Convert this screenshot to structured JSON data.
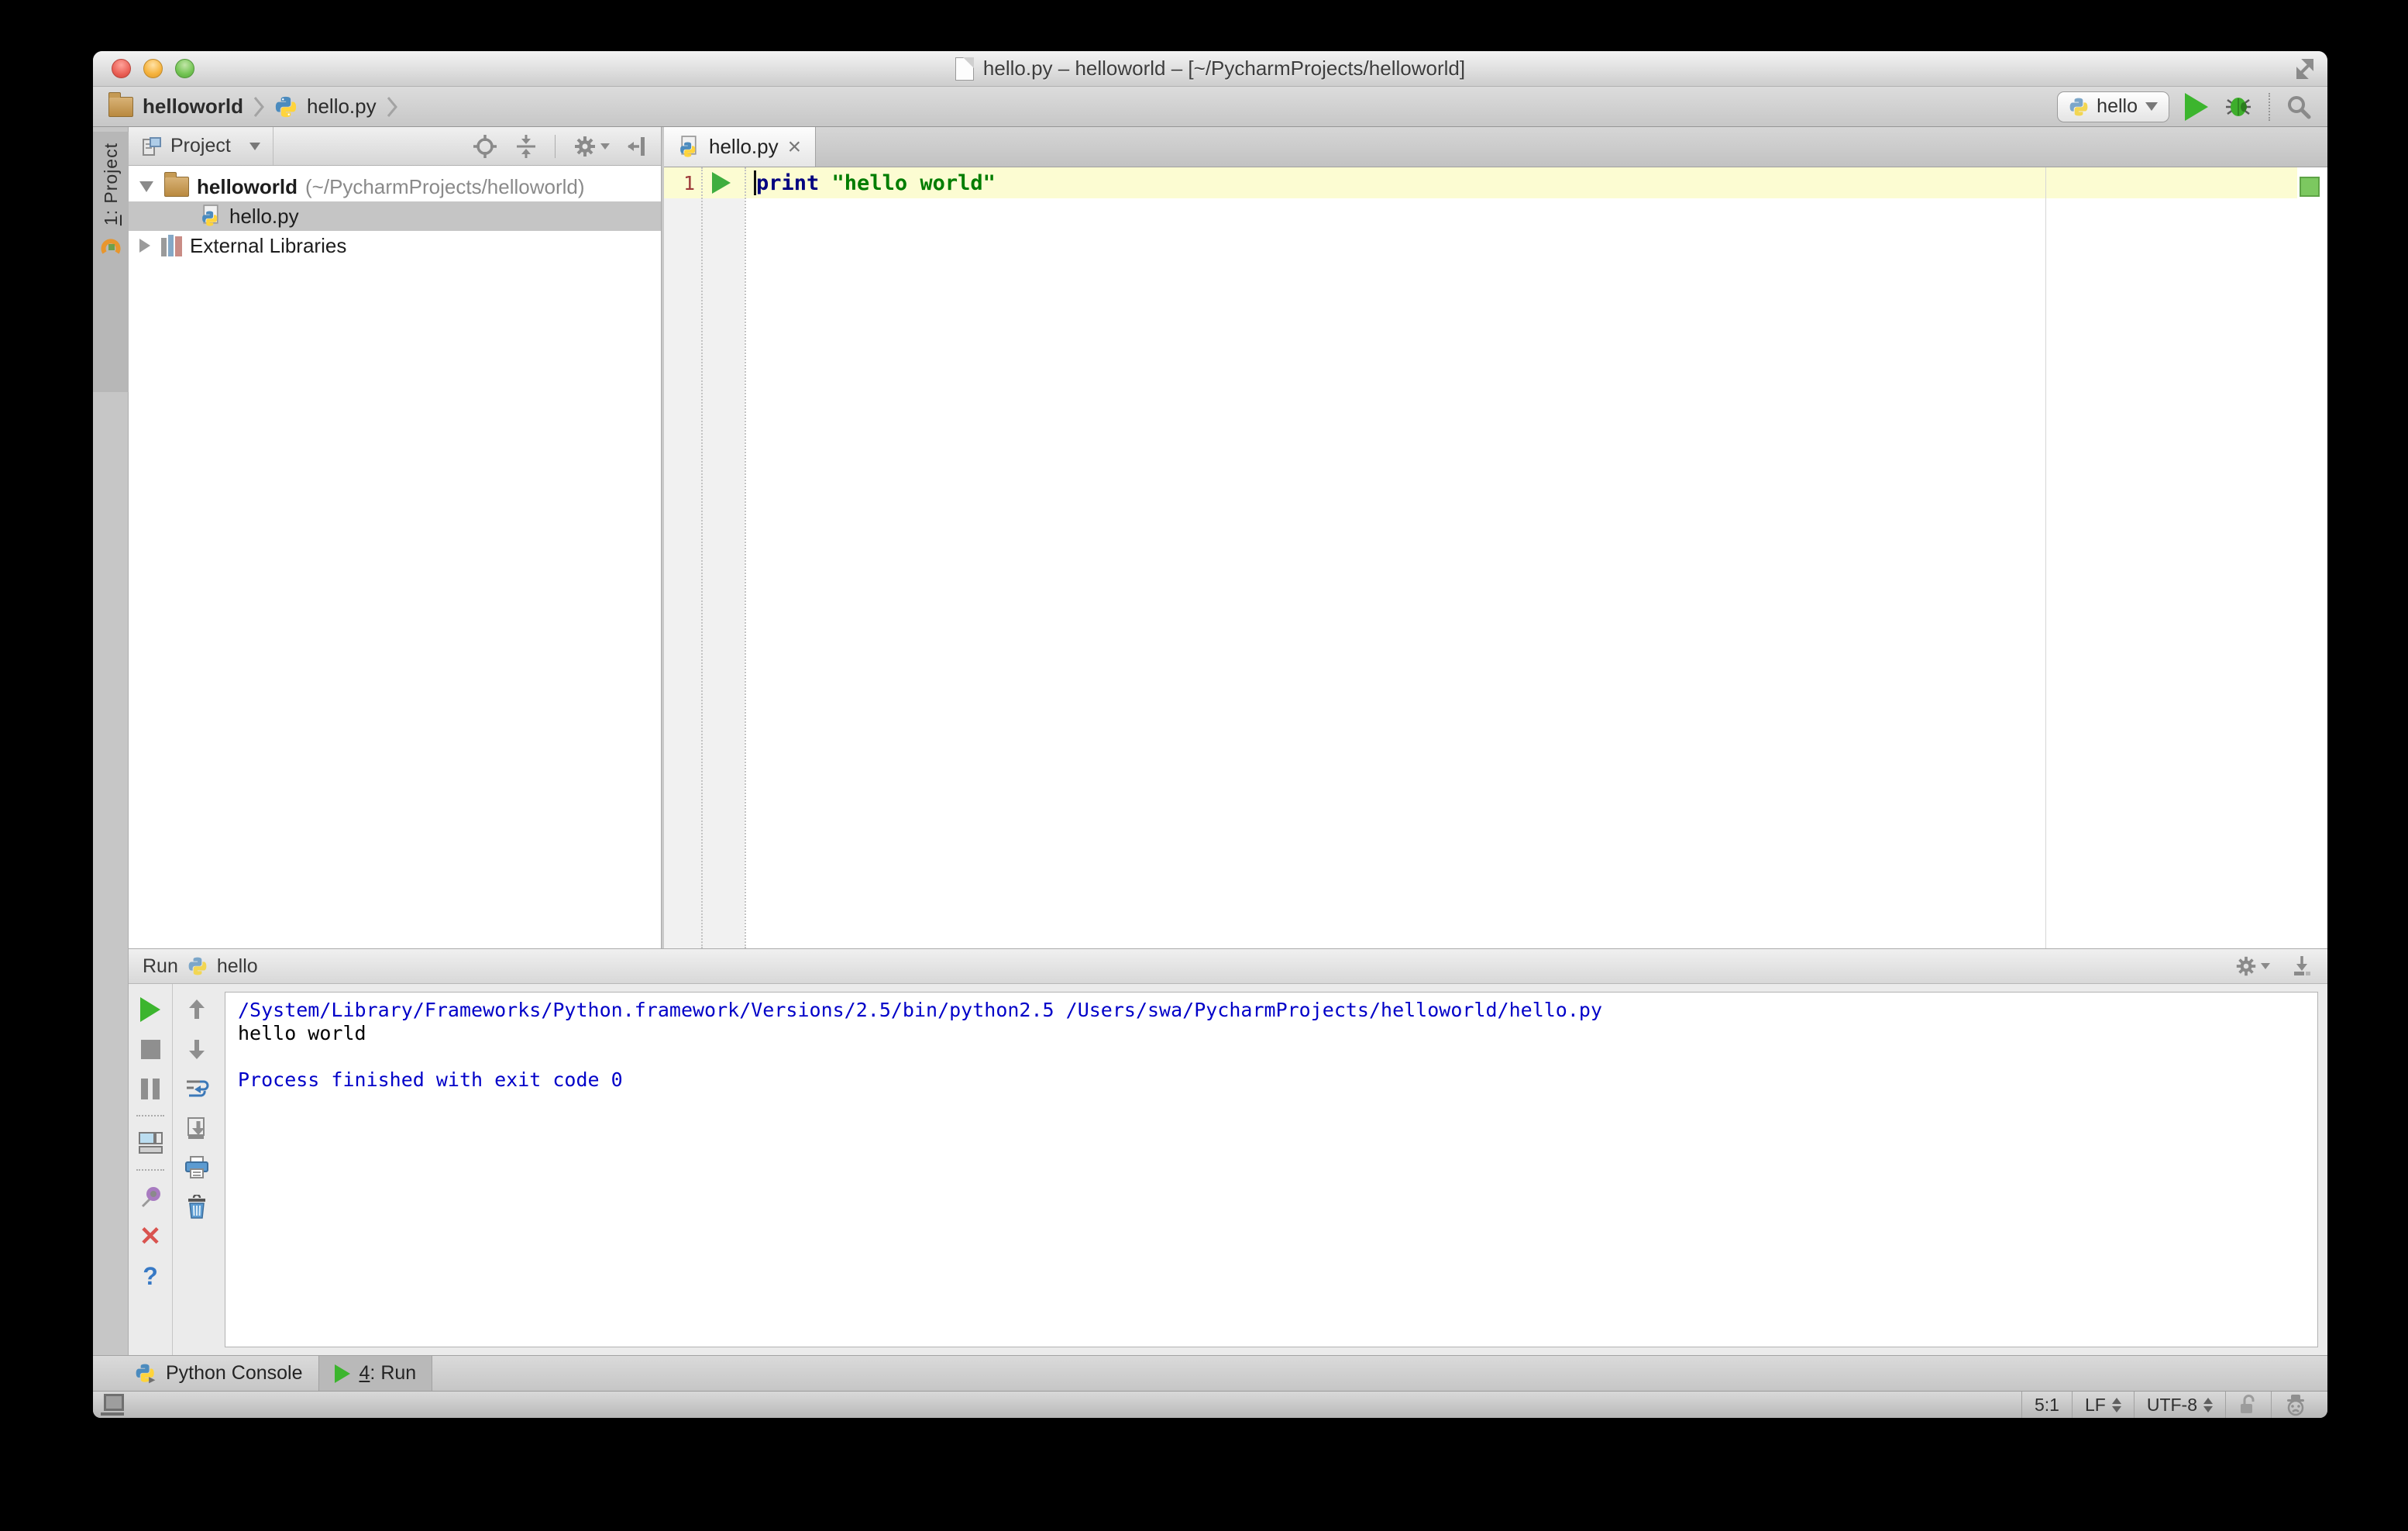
{
  "titlebar": {
    "title": "hello.py – helloworld – [~/PycharmProjects/helloworld]"
  },
  "navbar": {
    "breadcrumb_project": "helloworld",
    "breadcrumb_file": "hello.py",
    "run_config_label": "hello"
  },
  "tool_stripe": {
    "project_number": "1",
    "project_label": ": Project"
  },
  "project_panel": {
    "view_selector": "Project",
    "tree": {
      "root_name": "helloworld",
      "root_path": "(~/PycharmProjects/helloworld)",
      "file_name": "hello.py",
      "libraries_label": "External Libraries"
    }
  },
  "editor": {
    "tab_label": "hello.py",
    "line_number": "1",
    "code_keyword": "print",
    "code_string": "\"hello world\""
  },
  "run_panel": {
    "title": "Run",
    "config_name": "hello",
    "console_lines": [
      {
        "text": "/System/Library/Frameworks/Python.framework/Versions/2.5/bin/python2.5 /Users/swa/PycharmProjects/helloworld/hello.py",
        "type": "system"
      },
      {
        "text": "hello world",
        "type": "stdout"
      },
      {
        "text": "",
        "type": "stdout"
      },
      {
        "text": "Process finished with exit code 0",
        "type": "system"
      }
    ]
  },
  "bottom_bar": {
    "python_console_label": "Python Console",
    "run_tab_number": "4",
    "run_tab_suffix": ": Run"
  },
  "status_bar": {
    "caret": "5:1",
    "line_ending": "LF",
    "encoding": "UTF-8"
  },
  "colors": {
    "run_green": "#3CB52E",
    "keyword_blue": "#000080",
    "string_green": "#007D00",
    "console_system_blue": "#0000C8",
    "line_number_red": "#9E3A3A",
    "current_line_yellow": "#FCFCD2",
    "inspection_ok_green": "#7CC860"
  }
}
